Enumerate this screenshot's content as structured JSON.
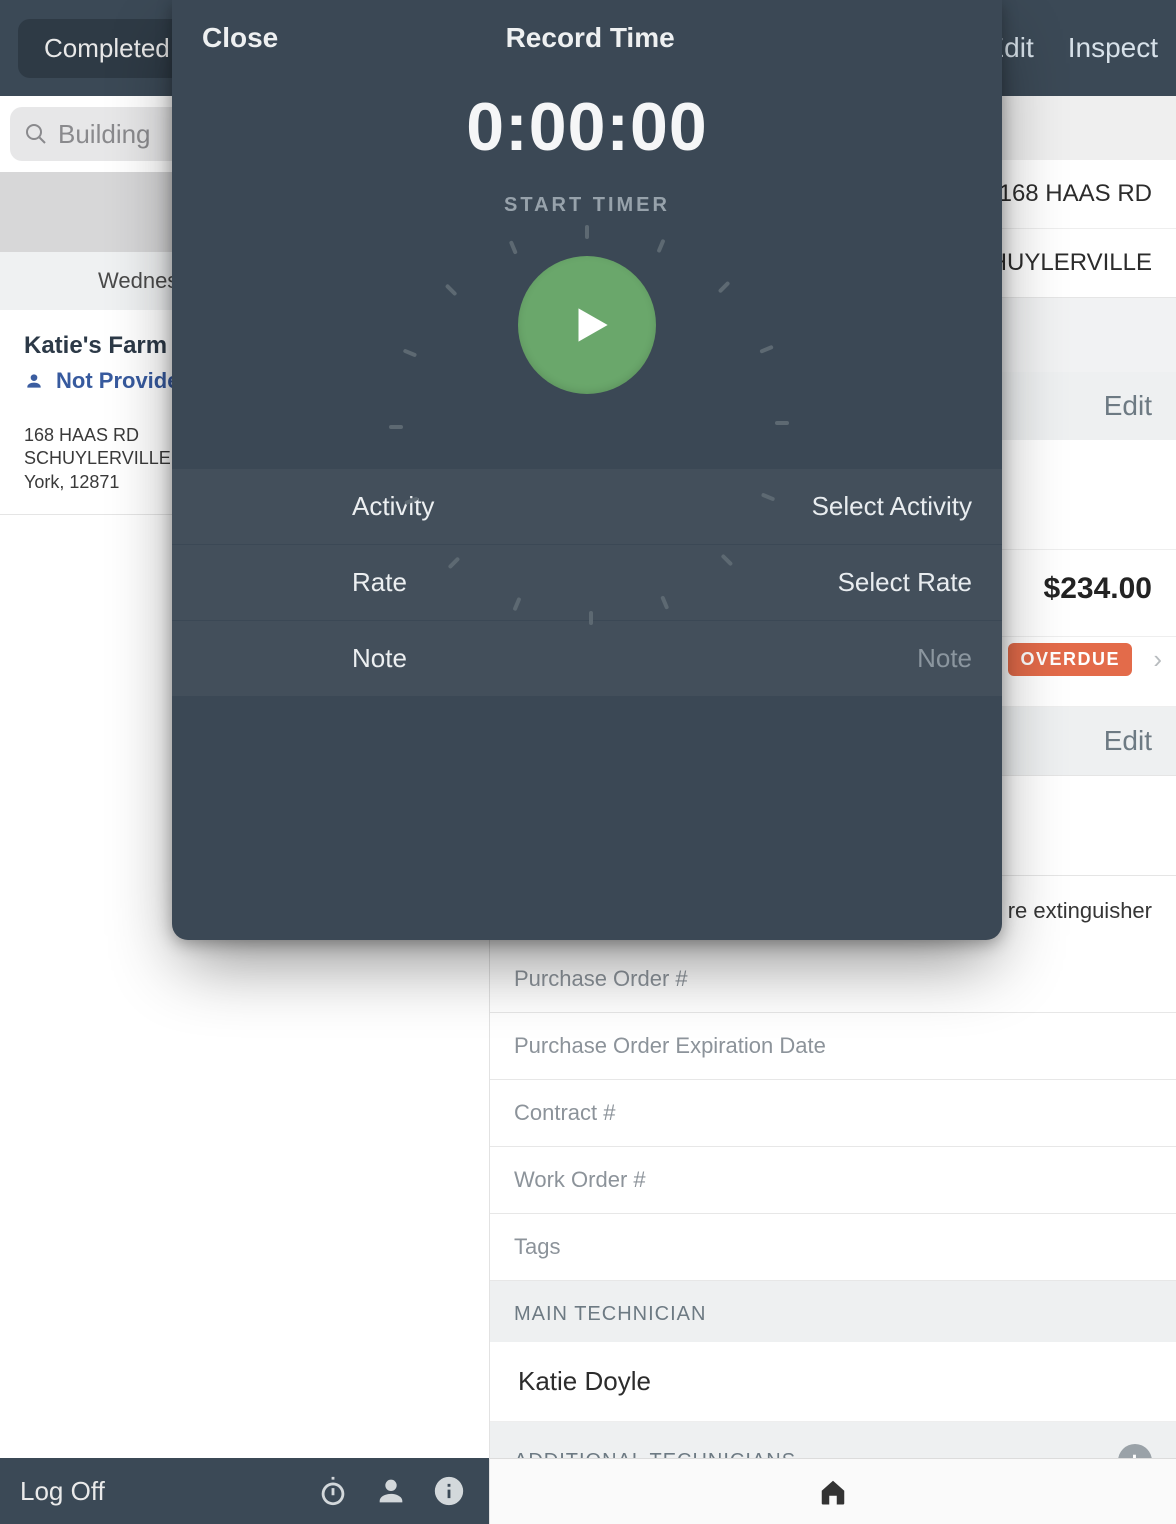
{
  "topbar": {
    "completed": "Completed",
    "edit": "Edit",
    "inspect": "Inspect"
  },
  "search": {
    "placeholder": "Building"
  },
  "left": {
    "date_header": "Wednes",
    "job": {
      "title": "Katie's Farm",
      "contact": "Not Provided",
      "addr1": "168 HAAS RD",
      "addr2": "SCHUYLERVILLE, N",
      "addr3": "York, 12871"
    },
    "footer": {
      "logoff": "Log Off"
    }
  },
  "right": {
    "addr1": "168 HAAS RD",
    "addr2": "SCHUYLERVILLE",
    "edit1": "Edit",
    "edit2": "Edit",
    "balance": "$234.00",
    "overdue": "OVERDUE",
    "desc": "re extinguisher",
    "fields": {
      "po": "Purchase Order #",
      "po_exp": "Purchase Order Expiration Date",
      "contract": "Contract #",
      "wo": "Work Order #",
      "tags": "Tags"
    },
    "sections": {
      "main_tech": "MAIN TECHNICIAN",
      "main_tech_value": "Katie Doyle",
      "addl_tech": "ADDITIONAL TECHNICIANS"
    }
  },
  "modal": {
    "close": "Close",
    "title": "Record Time",
    "timer_value": "0:00:00",
    "start_label": "START TIMER",
    "rows": {
      "activity_label": "Activity",
      "activity_value": "Select Activity",
      "rate_label": "Rate",
      "rate_value": "Select Rate",
      "note_label": "Note",
      "note_placeholder": "Note"
    }
  }
}
